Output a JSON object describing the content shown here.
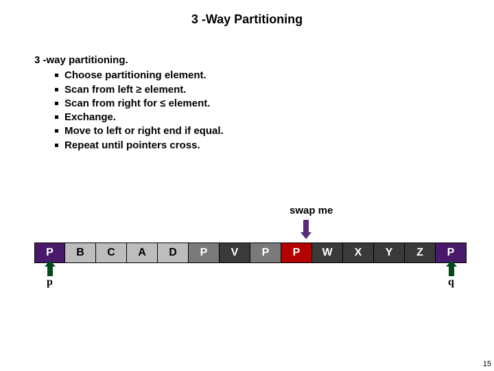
{
  "title": "3 -Way Partitioning",
  "heading": "3 -way partitioning.",
  "bullets": [
    "Choose partitioning element.",
    "Scan from left ≥ element.",
    "Scan from right for ≤  element.",
    "Exchange.",
    "Move to left or right end if equal.",
    "Repeat until pointers cross."
  ],
  "swap_label": "swap me",
  "array": [
    {
      "v": "P",
      "c": "c-purple"
    },
    {
      "v": "B",
      "c": "c-ltgray"
    },
    {
      "v": "C",
      "c": "c-ltgray"
    },
    {
      "v": "A",
      "c": "c-ltgray"
    },
    {
      "v": "D",
      "c": "c-ltgray"
    },
    {
      "v": "P",
      "c": "c-mdgray"
    },
    {
      "v": "V",
      "c": "c-dkgray"
    },
    {
      "v": "P",
      "c": "c-mdgray"
    },
    {
      "v": "P",
      "c": "c-red"
    },
    {
      "v": "W",
      "c": "c-dkgray"
    },
    {
      "v": "X",
      "c": "c-dkgray"
    },
    {
      "v": "Y",
      "c": "c-dkgray"
    },
    {
      "v": "Z",
      "c": "c-dkgray"
    },
    {
      "v": "P",
      "c": "c-purple"
    }
  ],
  "pointers": {
    "p": "p",
    "q": "q"
  },
  "page_number": "15"
}
